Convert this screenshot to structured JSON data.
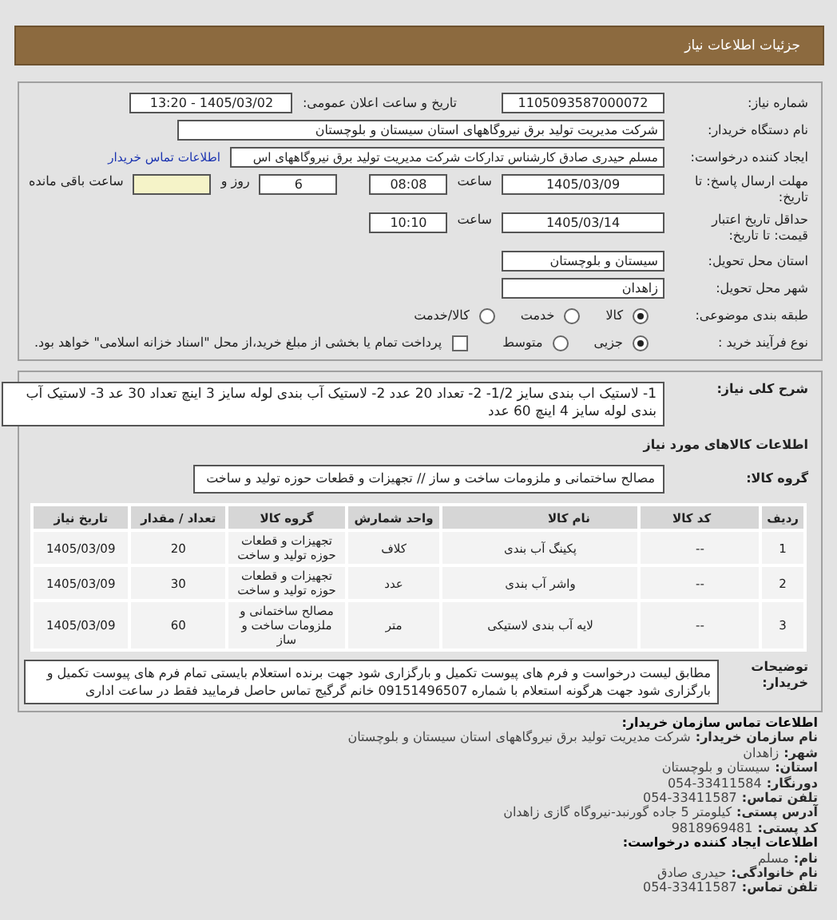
{
  "header": {
    "title": "جزئیات اطلاعات نیاز"
  },
  "need": {
    "number_label": "شماره نیاز:",
    "number": "1105093587000072",
    "announce_label": "تاریخ و ساعت اعلان عمومی:",
    "announce": "1405/03/02 - 13:20",
    "buyer_label": "نام دستگاه خریدار:",
    "buyer": "شرکت مدیریت تولید برق نیروگاههای استان سیستان و بلوچستان",
    "requester_label": "ایجاد کننده درخواست:",
    "requester": "مسلم حیدری صادق کارشناس تدارکات شرکت مدیریت تولید برق نیروگاههای اس",
    "contact_link": "اطلاعات تماس خریدار",
    "deadline_label": "مهلت ارسال پاسخ: تا تاریخ:",
    "deadline_date": "1405/03/09",
    "deadline_time_label": "ساعت",
    "deadline_time": "08:08",
    "days": "6",
    "days_label": "روز و",
    "remaining_label": "ساعت باقی مانده",
    "validity_label": "حداقل تاریخ اعتبار قیمت: تا تاریخ:",
    "validity_date": "1405/03/14",
    "validity_time_label": "ساعت",
    "validity_time": "10:10",
    "province_label": "استان محل تحویل:",
    "province": "سیستان و بلوچستان",
    "city_label": "شهر محل تحویل:",
    "city": "زاهدان",
    "category_label": "طبقه بندی موضوعی:",
    "category": [
      {
        "label": "کالا",
        "selected": true
      },
      {
        "label": "خدمت",
        "selected": false
      },
      {
        "label": "کالا/خدمت",
        "selected": false
      }
    ],
    "process_label": "نوع فرآیند خرید :",
    "process": [
      {
        "label": "جزیی",
        "selected": true
      },
      {
        "label": "متوسط",
        "selected": false
      }
    ],
    "treasury": {
      "label": "پرداخت تمام یا بخشی از مبلغ خرید،از محل \"اسناد خزانه اسلامی\" خواهد بود.",
      "checked": false
    }
  },
  "details": {
    "description_label": "شرح کلی نیاز:",
    "description": "1- لاستیک اب بندی سایز 1/2- 2- تعداد 20 عدد 2- لاستیک آب بندی لوله سایز 3 اینچ تعداد 30 عد 3- لاستیک آب بندی لوله سایز 4 اینچ 60 عدد",
    "goods_title": "اطلاعات کالاهای مورد نیاز",
    "group_label": "گروه کالا:",
    "group": "مصالح ساختمانی و ملزومات ساخت و ساز // تجهیزات و قطعات حوزه تولید و ساخت",
    "table": {
      "columns": [
        "ردیف",
        "کد کالا",
        "نام کالا",
        "واحد شمارش",
        "گروه کالا",
        "تعداد / مقدار",
        "تاریخ نیاز"
      ],
      "rows": [
        [
          "1",
          "--",
          "پکینگ آب بندی",
          "کلاف",
          "تجهیزات و قطعات حوزه تولید و ساخت",
          "20",
          "1405/03/09"
        ],
        [
          "2",
          "--",
          "واشر آب بندی",
          "عدد",
          "تجهیزات و قطعات حوزه تولید و ساخت",
          "30",
          "1405/03/09"
        ],
        [
          "3",
          "--",
          "لایه آب بندی لاستیکی",
          "متر",
          "مصالح ساختمانی و ملزومات ساخت و ساز",
          "60",
          "1405/03/09"
        ]
      ]
    },
    "notes_label": "توضیحات خریدار:",
    "notes": "مطابق لیست درخواست و فرم های پیوست تکمیل و بارگزاری شود جهت برنده استعلام بایستی تمام فرم های پیوست تکمیل و بارگزاری شود جهت هرگونه استعلام با شماره 09151496507 خانم گرگیج تماس حاصل فرمایید فقط در ساعت اداری"
  },
  "contact": [
    {
      "kind": "heading",
      "label": "اطلاعات تماس سازمان خریدار:"
    },
    {
      "kind": "line",
      "label": "نام سازمان خریدار:",
      "value": "شرکت مدیریت تولید برق نیروگاههای استان سیستان و بلوچستان"
    },
    {
      "kind": "line",
      "label": "شهر:",
      "value": "زاهدان"
    },
    {
      "kind": "line",
      "label": "استان:",
      "value": "سیستان و بلوچستان"
    },
    {
      "kind": "line",
      "label": "دورنگار:",
      "value": "054-33411584"
    },
    {
      "kind": "line",
      "label": "تلفن تماس:",
      "value": "054-33411587"
    },
    {
      "kind": "line",
      "label": "آدرس پستی:",
      "value": "کیلومتر 5 جاده گورنبد-نیروگاه گازی زاهدان"
    },
    {
      "kind": "line",
      "label": "کد پستی:",
      "value": "9818969481"
    },
    {
      "kind": "heading",
      "label": "اطلاعات ایجاد کننده درخواست:"
    },
    {
      "kind": "line",
      "label": "نام:",
      "value": "مسلم"
    },
    {
      "kind": "line",
      "label": "نام خانوادگی:",
      "value": "حیدری صادق"
    },
    {
      "kind": "line",
      "label": "تلفن تماس:",
      "value": "054-33411587"
    }
  ]
}
